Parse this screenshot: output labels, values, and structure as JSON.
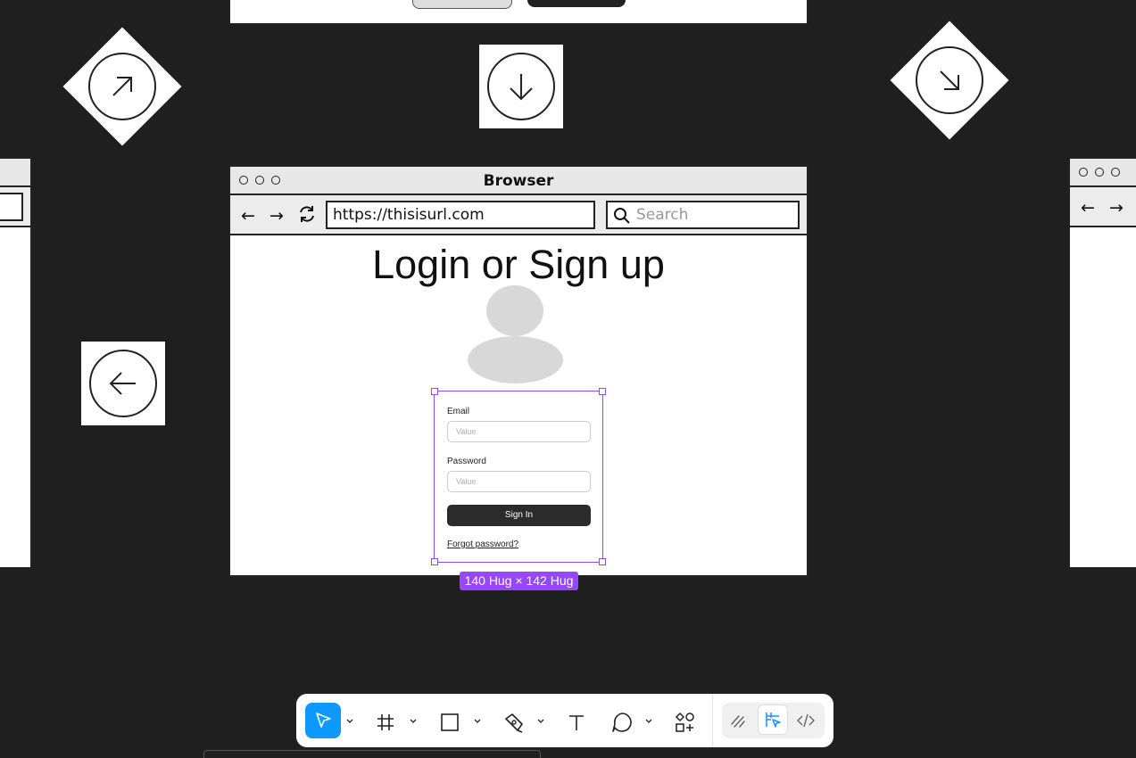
{
  "browser": {
    "title": "Browser",
    "url": "https://thisisurl.com",
    "search_placeholder": "Search"
  },
  "page": {
    "heading": "Login or Sign up"
  },
  "form": {
    "email_label": "Email",
    "email_placeholder": "Value",
    "password_label": "Password",
    "password_placeholder": "Value",
    "signin_label": "Sign In",
    "forgot_label": "Forgot password?"
  },
  "selection": {
    "size_label": "140 Hug × 142 Hug",
    "color": "#9747ff"
  },
  "toolbar": {
    "tools": [
      "move-tool",
      "frame-tool",
      "rectangle-tool",
      "pen-tool",
      "text-tool",
      "comment-tool",
      "actions-tool"
    ],
    "modes": [
      "draw-mode",
      "design-mode",
      "dev-mode"
    ],
    "active_tool": "move-tool",
    "active_mode": "design-mode",
    "accent": "#0d99ff"
  },
  "canvas": {
    "background": "#1f1f1f"
  }
}
